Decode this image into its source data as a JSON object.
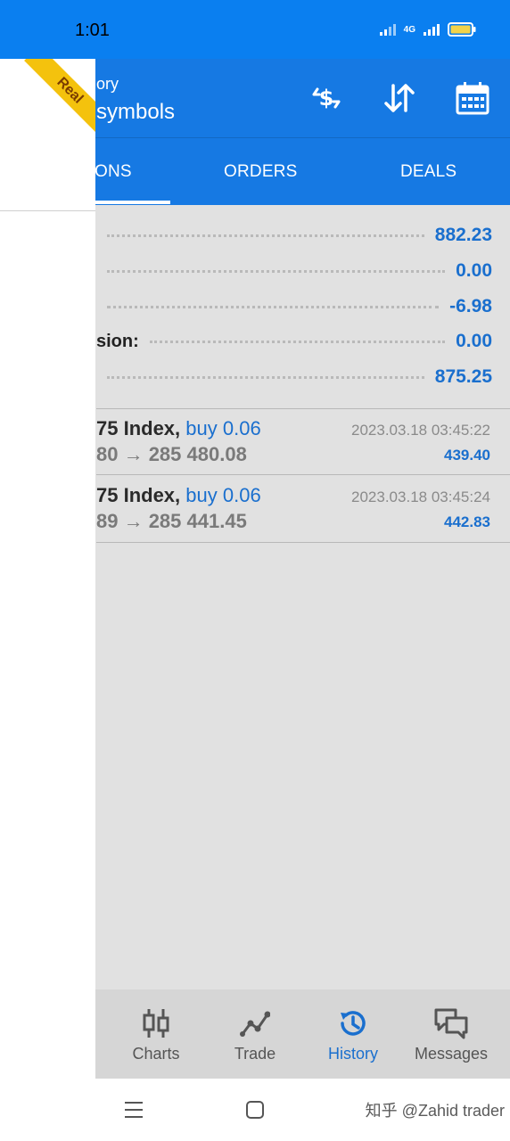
{
  "status_bar": {
    "time": "1:01",
    "network": "4G"
  },
  "header": {
    "title_small": "ory",
    "title_main": "symbols"
  },
  "badge": {
    "label": "Real"
  },
  "tabs": [
    {
      "label": "ONS"
    },
    {
      "label": "ORDERS"
    },
    {
      "label": "DEALS"
    }
  ],
  "summary": [
    {
      "label": "",
      "value": "882.23"
    },
    {
      "label": "",
      "value": "0.00"
    },
    {
      "label": "",
      "value": "-6.98"
    },
    {
      "label": "sion:",
      "value": "0.00"
    },
    {
      "label": "",
      "value": "875.25"
    }
  ],
  "deals": [
    {
      "symbol": "75 Index,",
      "side": "buy 0.06",
      "price": "80 → 285 480.08",
      "time": "2023.03.18 03:45:22",
      "profit": "439.40"
    },
    {
      "symbol": "75 Index,",
      "side": "buy 0.06",
      "price": "89 → 285 441.45",
      "time": "2023.03.18 03:45:24",
      "profit": "442.83"
    }
  ],
  "bottom_nav": [
    {
      "label": "Charts",
      "icon": "candlestick-icon"
    },
    {
      "label": "Trade",
      "icon": "trade-line-icon"
    },
    {
      "label": "History",
      "icon": "history-clock-icon",
      "active": true
    },
    {
      "label": "Messages",
      "icon": "messages-icon"
    }
  ],
  "watermark": "知乎 @Zahid trader",
  "colors": {
    "header_blue": "#1679e3",
    "value_blue": "#1a6fce",
    "active_nav": "#1a6fce"
  }
}
